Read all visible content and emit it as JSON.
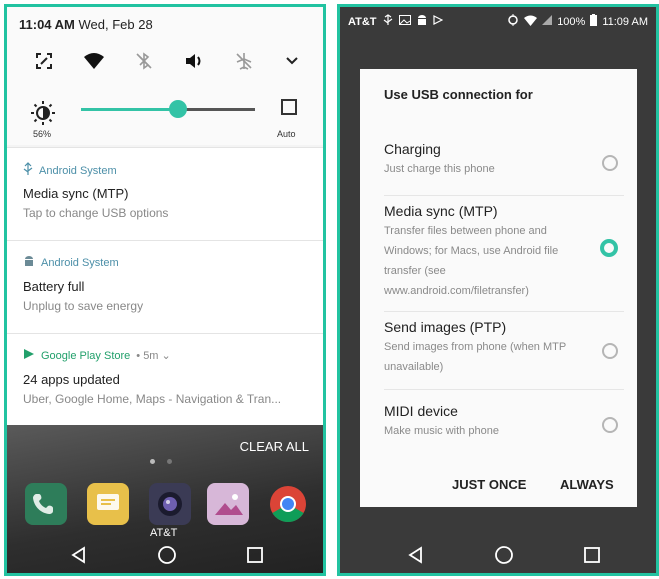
{
  "left": {
    "status": {
      "time": "11:04 AM",
      "date": "Wed, Feb 28"
    },
    "quick_settings": {
      "icons": [
        "screen-rotate-icon",
        "wifi-icon",
        "bluetooth-off-icon",
        "sound-icon",
        "airplane-off-icon",
        "chevron-down-icon"
      ],
      "brightness_pct": "56%",
      "brightness_value": 0.56,
      "auto_label": "Auto"
    },
    "notifications": [
      {
        "app": "Android System",
        "title": "Media sync (MTP)",
        "subtitle": "Tap to change USB options"
      },
      {
        "app": "Android System",
        "title": "Battery full",
        "subtitle": "Unplug to save energy"
      },
      {
        "app": "Google Play Store",
        "meta": "• 5m ⌄",
        "title": "24 apps updated",
        "subtitle": "Uber, Google Home, Maps - Navigation & Tran..."
      }
    ],
    "home": {
      "clear_all": "CLEAR ALL",
      "carrier_label": "AT&T"
    }
  },
  "right": {
    "status": {
      "carrier": "AT&T",
      "battery": "100%",
      "time": "11:09 AM"
    },
    "dialog": {
      "title": "Use USB connection for",
      "options": [
        {
          "title": "Charging",
          "desc": "Just charge this phone",
          "selected": false
        },
        {
          "title": "Media sync (MTP)",
          "desc": "Transfer files between phone and Windows; for Macs, use Android file transfer (see www.android.com/filetransfer)",
          "selected": true
        },
        {
          "title": "Send images (PTP)",
          "desc": "Send images from phone (when MTP unavailable)",
          "selected": false
        },
        {
          "title": "MIDI device",
          "desc": "Make music with phone",
          "selected": false
        }
      ],
      "buttons": {
        "just_once": "JUST ONCE",
        "always": "ALWAYS"
      }
    }
  },
  "colors": {
    "accent": "#33c3a6",
    "border": "#22c3a1"
  }
}
